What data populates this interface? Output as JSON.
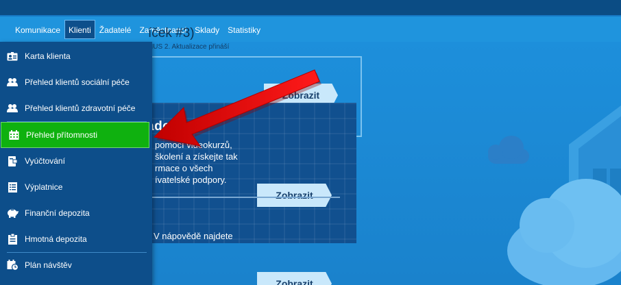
{
  "nav": {
    "items": [
      {
        "label": "Komunikace"
      },
      {
        "label": "Klienti"
      },
      {
        "label": "Žadatelé"
      },
      {
        "label": "Zaměstnanci"
      },
      {
        "label": "Sklady"
      },
      {
        "label": "Statistiky"
      }
    ],
    "active_index": 1
  },
  "dropdown": {
    "items": [
      {
        "label": "Karta klienta",
        "icon": "id-card-icon"
      },
      {
        "label": "Přehled klientů sociální péče",
        "icon": "users-icon"
      },
      {
        "label": "Přehled klientů zdravotní péče",
        "icon": "users-icon"
      },
      {
        "label": "Přehled přítomnosti",
        "icon": "calendar-icon"
      },
      {
        "label": "Vyúčtování",
        "icon": "wallet-icon"
      },
      {
        "label": "Výplatnice",
        "icon": "document-list-icon"
      },
      {
        "label": "Finanční depozita",
        "icon": "piggy-bank-icon"
      },
      {
        "label": "Hmotná depozita",
        "icon": "clipboard-icon"
      },
      {
        "label": "Plán návštěv",
        "icon": "calendar-clock-icon"
      }
    ],
    "highlighted_index": 3
  },
  "panel_top": {
    "title": "íček #3)",
    "subtitle": "NUS 2. Aktualizace přináší",
    "button_label": "Zobrazit"
  },
  "academy": {
    "title": "ademie",
    "text": "pomocí videokurzů,\nškolení a získejte tak\nrmace o všech\nívatelské podpory.",
    "button_label": "Zobrazit"
  },
  "help": {
    "text": "V nápovědě najdete",
    "button_label": "Zobrazit"
  },
  "colors": {
    "dropdown_bg": "#0d4e8a",
    "highlight": "#0fb10f",
    "arrow": "#e00000"
  }
}
